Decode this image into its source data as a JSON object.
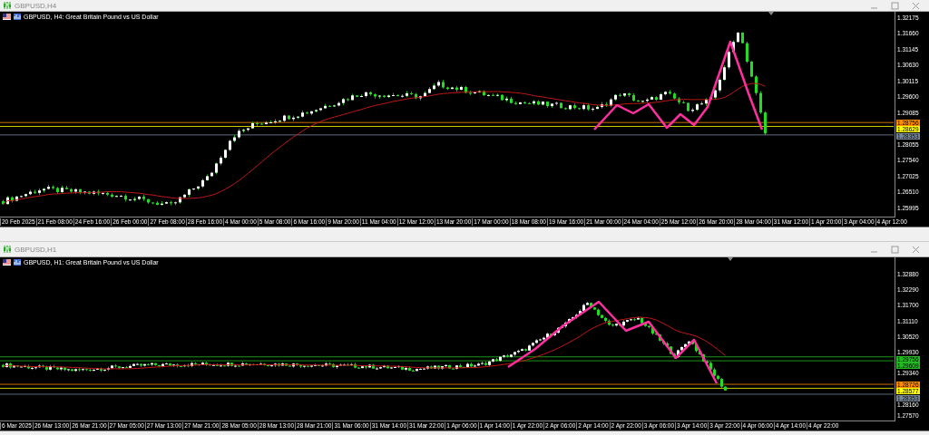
{
  "windows": [
    {
      "title": "GBPUSD,H4",
      "chart_label": "GBPUSD, H4:  Great Britain Pound vs US Dollar",
      "price_ticks": [
        "1.32175",
        "1.31660",
        "1.31145",
        "1.30630",
        "1.30115",
        "1.29600",
        "1.29085",
        "1.28055",
        "1.27540",
        "1.27025",
        "1.26510",
        "1.25995"
      ],
      "price_tags": [
        {
          "price": "1.28756",
          "color": "#ff8c00"
        },
        {
          "price": "1.28629",
          "color": "#ffff00"
        },
        {
          "price": "1.28353",
          "color": "#778899"
        }
      ],
      "time_labels": [
        "20 Feb 2025",
        "21 Feb 08:00",
        "24 Feb 16:00",
        "26 Feb 00:00",
        "27 Feb 08:00",
        "28 Feb 16:00",
        "4 Mar 00:00",
        "5 Mar 08:00",
        "6 Mar 16:00",
        "9 Mar 20:00",
        "11 Mar 04:00",
        "12 Mar 12:00",
        "13 Mar 20:00",
        "17 Mar 00:00",
        "18 Mar 08:00",
        "19 Mar 16:00",
        "21 Mar 00:00",
        "24 Mar 04:00",
        "25 Mar 12:00",
        "26 Mar 20:00",
        "28 Mar 04:00",
        "31 Mar 12:00",
        "1 Apr 20:00",
        "3 Apr 04:00",
        "4 Apr 12:00"
      ]
    },
    {
      "title": "GBPUSD,H1",
      "chart_label": "GBPUSD, H1:  Great Britain Pound vs US Dollar",
      "price_ticks": [
        "1.32880",
        "1.32290",
        "1.31700",
        "1.31110",
        "1.30520",
        "1.29930",
        "1.29340",
        "1.28160",
        "1.27570"
      ],
      "price_tags": [
        {
          "price": "1.29756",
          "color": "#22bb22"
        },
        {
          "price": "1.29609",
          "color": "#22bb22"
        },
        {
          "price": "1.28726",
          "color": "#ff8c00"
        },
        {
          "price": "1.28577",
          "color": "#ffff00"
        },
        {
          "price": "1.28353",
          "color": "#778899"
        }
      ],
      "time_labels": [
        "6 Mar 2025",
        "26 Mar 13:00",
        "26 Mar 21:00",
        "27 Mar 05:00",
        "27 Mar 13:00",
        "27 Mar 21:00",
        "28 Mar 05:00",
        "28 Mar 13:00",
        "28 Mar 21:00",
        "31 Mar 06:00",
        "31 Mar 14:00",
        "31 Mar 22:00",
        "1 Apr 06:00",
        "1 Apr 14:00",
        "1 Apr 22:00",
        "2 Apr 06:00",
        "2 Apr 14:00",
        "2 Apr 22:00",
        "3 Apr 06:00",
        "3 Apr 14:00",
        "3 Apr 22:00",
        "4 Apr 06:00",
        "4 Apr 14:00",
        "4 Apr 22:00"
      ]
    }
  ]
}
